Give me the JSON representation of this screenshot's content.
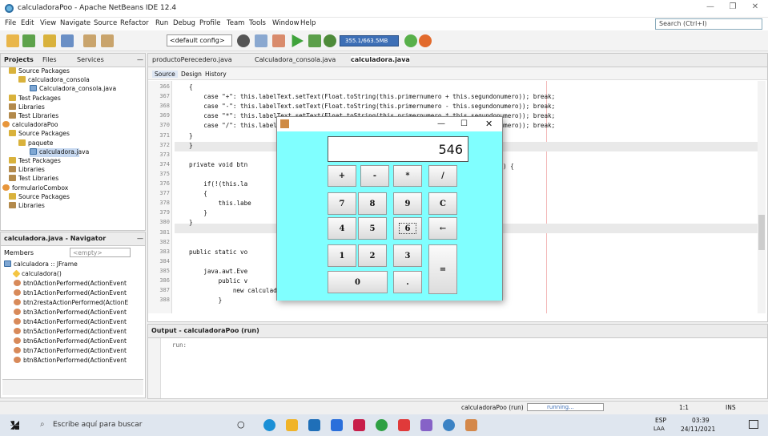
{
  "window": {
    "title": "calculadoraPoo - Apache NetBeans IDE 12.4"
  },
  "menu": [
    "File",
    "Edit",
    "View",
    "Navigate",
    "Source",
    "Refactor",
    "Run",
    "Debug",
    "Profile",
    "Team",
    "Tools",
    "Window",
    "Help"
  ],
  "search": {
    "placeholder": "Search (Ctrl+I)"
  },
  "toolbar": {
    "config": "<default config>",
    "memory": "355.1/663.5MB"
  },
  "projects_panel": {
    "tabs": [
      "Projects",
      "Files",
      "Services"
    ],
    "tree": [
      {
        "label": "Source Packages",
        "icon": "package-folder-icon"
      },
      {
        "label": "calculadora_consola",
        "icon": "package-icon"
      },
      {
        "label": "Calculadora_consola.java",
        "icon": "java-file-icon"
      },
      {
        "label": "Test Packages",
        "icon": "package-folder-icon"
      },
      {
        "label": "Libraries",
        "icon": "library-icon"
      },
      {
        "label": "Test Libraries",
        "icon": "library-icon"
      },
      {
        "label": "calculadoraPoo",
        "icon": "project-icon"
      },
      {
        "label": "Source Packages",
        "icon": "package-folder-icon"
      },
      {
        "label": "paquete",
        "icon": "package-icon"
      },
      {
        "label": "calculadora.java",
        "icon": "java-file-icon"
      },
      {
        "label": "Test Packages",
        "icon": "package-folder-icon"
      },
      {
        "label": "Libraries",
        "icon": "library-icon"
      },
      {
        "label": "Test Libraries",
        "icon": "library-icon"
      },
      {
        "label": "formularioCombox",
        "icon": "project-icon"
      },
      {
        "label": "Source Packages",
        "icon": "package-folder-icon"
      },
      {
        "label": "Libraries",
        "icon": "library-icon"
      }
    ]
  },
  "navigator": {
    "title": "calculadora.java - Navigator",
    "members_label": "Members",
    "filter": "<empty>",
    "items": [
      "calculadora :: JFrame",
      "calculadora()",
      "btn0ActionPerformed(ActionEvent",
      "btn1ActionPerformed(ActionEvent",
      "btn2restaActionPerformed(ActionE",
      "btn3ActionPerformed(ActionEvent",
      "btn4ActionPerformed(ActionEvent",
      "btn5ActionPerformed(ActionEvent",
      "btn6ActionPerformed(ActionEvent",
      "btn7ActionPerformed(ActionEvent",
      "btn8ActionPerformed(ActionEvent"
    ]
  },
  "editor": {
    "tabs": [
      "productoPerecedero.java",
      "Calculadora_consola.java",
      "calculadora.java"
    ],
    "modes": [
      "Source",
      "Design",
      "History"
    ],
    "lines": [
      {
        "n": "366",
        "text": "{"
      },
      {
        "n": "367",
        "text": "    case \"+\": this.labelText.setText(Float.toString(this.primernumero + this.segundonumero)); break;"
      },
      {
        "n": "368",
        "text": "    case \"-\": this.labelText.setText(Float.toString(this.primernumero - this.segundonumero)); break;"
      },
      {
        "n": "369",
        "text": "    case \"*\": this.labelText.setText(Float.toString(this.primernumero * this.segundonumero)); break;"
      },
      {
        "n": "370",
        "text": "    case \"/\": this.labelText.setText(Float.toString(this.primernumero / this.segundonumero)); break;"
      },
      {
        "n": "371",
        "text": "}"
      },
      {
        "n": "372",
        "text": "}"
      },
      {
        "n": "373",
        "text": ""
      },
      {
        "n": "374",
        "text": "private void btn"
      },
      {
        "n": "375",
        "text": ""
      },
      {
        "n": "376",
        "text": "    if(!(this.la"
      },
      {
        "n": "377",
        "text": "    {"
      },
      {
        "n": "378",
        "text": "        this.labe"
      },
      {
        "n": "379",
        "text": "    }"
      },
      {
        "n": "380",
        "text": "}"
      },
      {
        "n": "381",
        "text": ""
      },
      {
        "n": "382",
        "text": ""
      },
      {
        "n": "383",
        "text": "public static vo"
      },
      {
        "n": "384",
        "text": ""
      },
      {
        "n": "385",
        "text": "    java.awt.Eve"
      },
      {
        "n": "386",
        "text": "        public v"
      },
      {
        "n": "387",
        "text": "            new calculadora().setVisible(true);"
      },
      {
        "n": "388",
        "text": "        }"
      }
    ],
    "trailing_brace": ") {"
  },
  "output": {
    "title": "Output - calculadoraPoo (run)",
    "text": "run:"
  },
  "status": {
    "project": "calculadoraPoo (run)",
    "progress": "running...",
    "position": "1:1",
    "mode": "INS"
  },
  "calculator": {
    "display": "546",
    "buttons": {
      "plus": "+",
      "minus": "-",
      "times": "*",
      "divide": "/",
      "seven": "7",
      "eight": "8",
      "nine": "9",
      "clear": "C",
      "four": "4",
      "five": "5",
      "six": "6",
      "back": "←",
      "one": "1",
      "two": "2",
      "three": "3",
      "equals": "=",
      "zero": "0",
      "dot": "."
    }
  },
  "taskbar": {
    "search_placeholder": "Escribe aquí para buscar",
    "lang": "ESP",
    "lang2": "LAA",
    "time": "03:39",
    "date": "24/11/2021"
  },
  "colors": {
    "calc_bg": "#80ffff",
    "memory_bar": "#3d6fb6"
  }
}
